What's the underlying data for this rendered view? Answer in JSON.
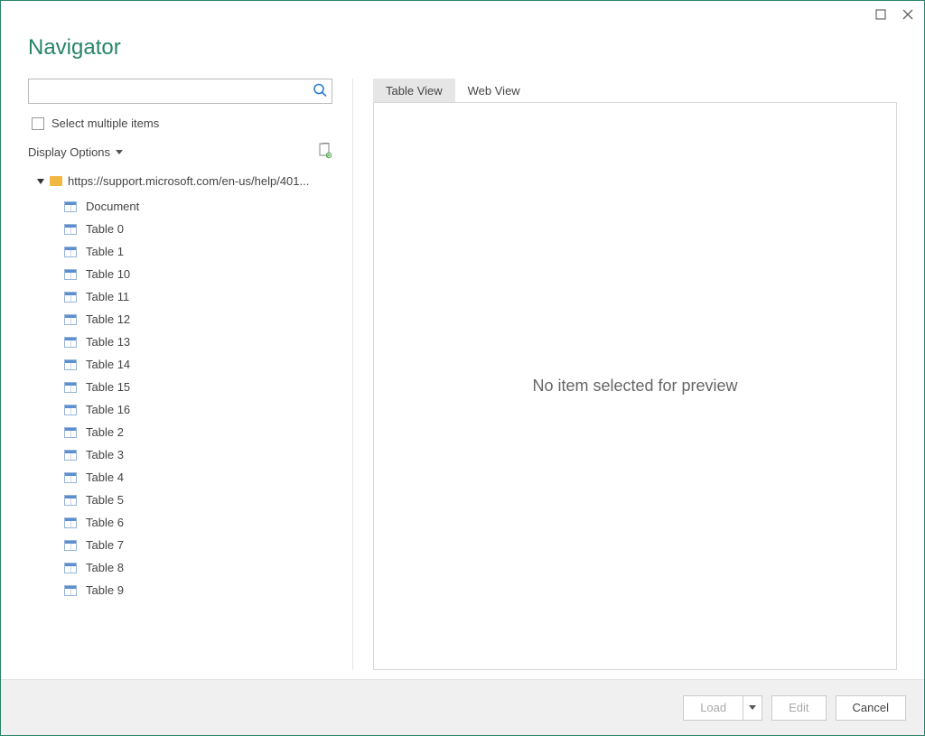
{
  "title": "Navigator",
  "search": {
    "placeholder": ""
  },
  "select_multi_label": "Select multiple items",
  "display_options_label": "Display Options",
  "root": {
    "label": "https://support.microsoft.com/en-us/help/401..."
  },
  "tree": [
    {
      "label": "Document"
    },
    {
      "label": "Table 0"
    },
    {
      "label": "Table 1"
    },
    {
      "label": "Table 10"
    },
    {
      "label": "Table 11"
    },
    {
      "label": "Table 12"
    },
    {
      "label": "Table 13"
    },
    {
      "label": "Table 14"
    },
    {
      "label": "Table 15"
    },
    {
      "label": "Table 16"
    },
    {
      "label": "Table 2"
    },
    {
      "label": "Table 3"
    },
    {
      "label": "Table 4"
    },
    {
      "label": "Table 5"
    },
    {
      "label": "Table 6"
    },
    {
      "label": "Table 7"
    },
    {
      "label": "Table 8"
    },
    {
      "label": "Table 9"
    }
  ],
  "tabs": {
    "table_view": "Table View",
    "web_view": "Web View"
  },
  "preview_empty": "No item selected for preview",
  "buttons": {
    "load": "Load",
    "edit": "Edit",
    "cancel": "Cancel"
  }
}
